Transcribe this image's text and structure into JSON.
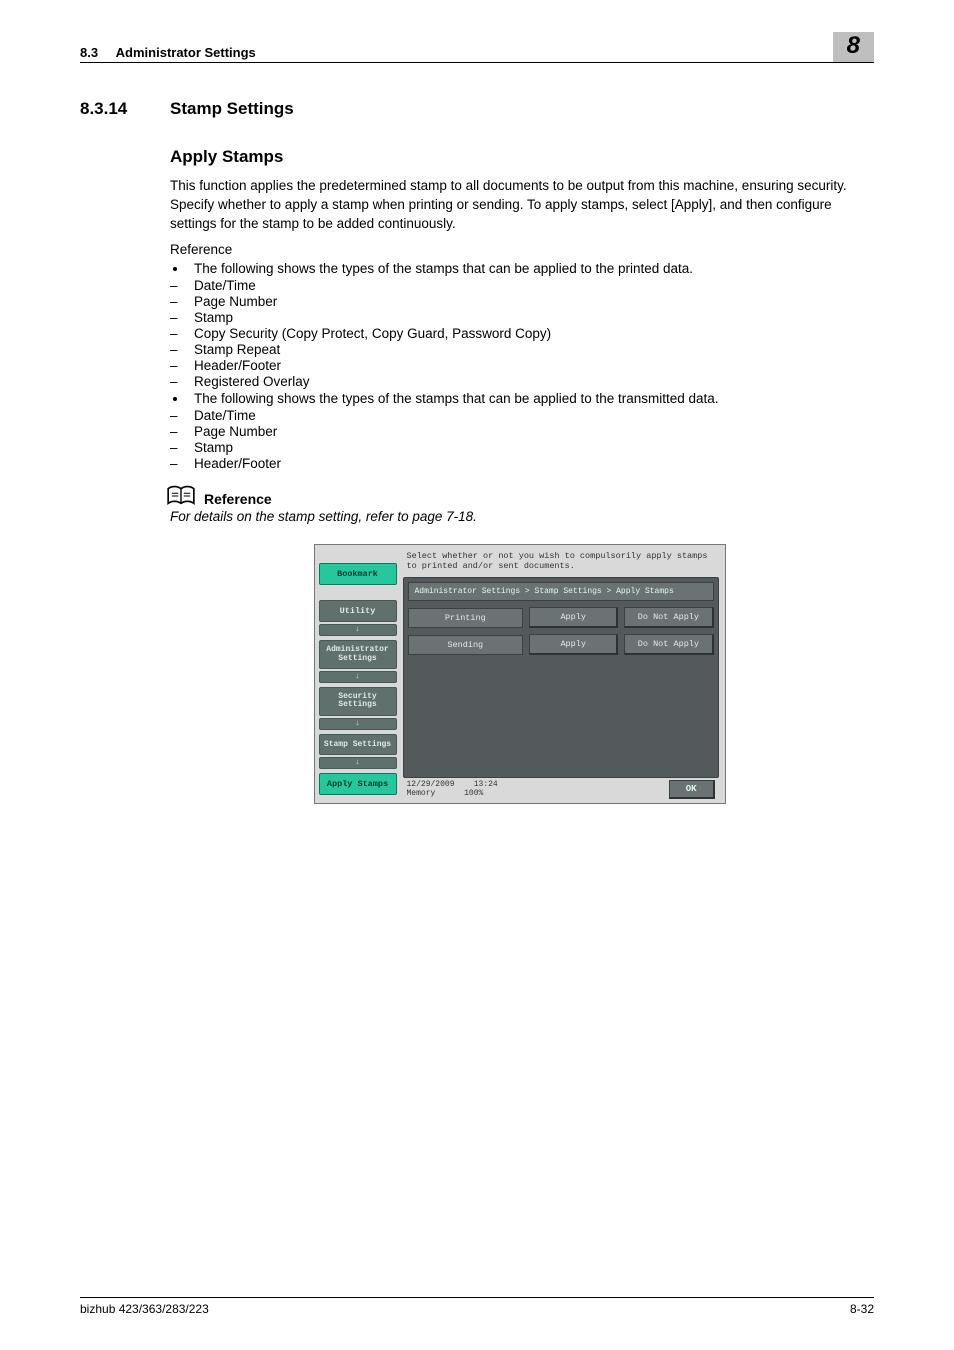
{
  "header": {
    "section_no": "8.3",
    "section_title": "Administrator Settings",
    "chapter_no": "8"
  },
  "heading": {
    "number": "8.3.14",
    "title": "Stamp Settings"
  },
  "subheading": "Apply Stamps",
  "intro_para": "This function applies the predetermined stamp to all documents to be output from this machine, ensuring security. Specify whether to apply a stamp when printing or sending. To apply stamps, select [Apply], and then configure settings for the stamp to be added continuously.",
  "reference_label": "Reference",
  "bullet_printed_intro": "The following shows the types of the stamps that can be applied to the printed data.",
  "printed_list": [
    "Date/Time",
    "Page Number",
    "Stamp",
    "Copy Security (Copy Protect, Copy Guard, Password Copy)",
    "Stamp Repeat",
    "Header/Footer",
    "Registered Overlay"
  ],
  "bullet_transmitted_intro": "The following shows the types of the stamps that can be applied to the transmitted data.",
  "transmitted_list": [
    "Date/Time",
    "Page Number",
    "Stamp",
    "Header/Footer"
  ],
  "reference_box": {
    "title": "Reference",
    "text": "For details on the stamp setting, refer to page 7-18."
  },
  "screenshot": {
    "nav": {
      "bookmark": "Bookmark",
      "utility": "Utility",
      "admin": "Administrator Settings",
      "security": "Security Settings",
      "stamp": "Stamp Settings",
      "apply": "Apply Stamps"
    },
    "instruction": "Select whether or not you wish to compulsorily apply stamps to printed and/or sent documents.",
    "breadcrumb": "Administrator Settings > Stamp Settings > Apply Stamps",
    "rows": [
      {
        "label": "Printing",
        "apply": "Apply",
        "not_apply": "Do Not Apply"
      },
      {
        "label": "Sending",
        "apply": "Apply",
        "not_apply": "Do Not Apply"
      }
    ],
    "footer": {
      "date": "12/29/2009",
      "time": "13:24",
      "memory_label": "Memory",
      "memory_value": "100%",
      "ok": "OK"
    }
  },
  "footer": {
    "model": "bizhub 423/363/283/223",
    "page": "8-32"
  }
}
